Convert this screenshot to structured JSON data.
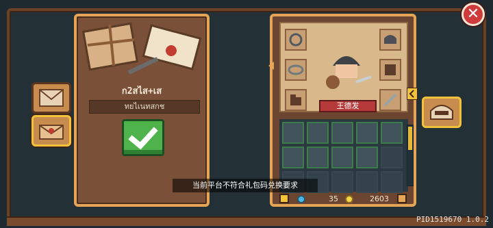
{
  "left_panel": {
    "title_label": "ก2สไส+เส",
    "code_value": "ทยไเนทสกช"
  },
  "hero": {
    "name": "王德发"
  },
  "currency": {
    "coin": "35",
    "gem": "2603"
  },
  "toast": "当前平台不符合礼包码兑换要求",
  "version": "PID1519670 1.0.2",
  "icons": {
    "close": "close-icon",
    "mail": "mail-icon",
    "gift": "gift-icon",
    "helmet": "helmet-icon",
    "check": "check-icon"
  }
}
